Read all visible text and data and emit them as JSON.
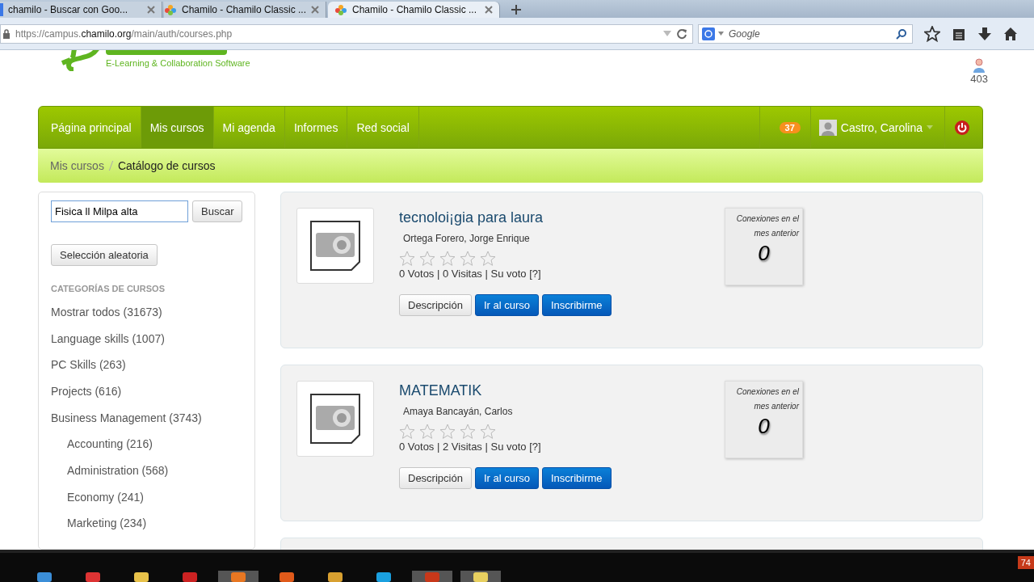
{
  "browser": {
    "tabs": [
      {
        "title": "chamilo - Buscar con Goo...",
        "selected": false,
        "kind": "google"
      },
      {
        "title": "Chamilo - Chamilo Classic ...",
        "selected": false,
        "kind": "chamilo"
      },
      {
        "title": "Chamilo - Chamilo Classic ...",
        "selected": true,
        "kind": "chamilo"
      }
    ],
    "url": {
      "prefix": "https://campus.",
      "domain": "chamilo.org",
      "path": "/main/auth/courses.php"
    },
    "search_placeholder": "Google"
  },
  "header": {
    "tagline": "E-Learning & Collaboration Software",
    "online_count": "403"
  },
  "nav": {
    "items": [
      {
        "label": "Página principal",
        "selected": false
      },
      {
        "label": "Mis cursos",
        "selected": true
      },
      {
        "label": "Mi agenda",
        "selected": false
      },
      {
        "label": "Informes",
        "selected": false
      },
      {
        "label": "Red social",
        "selected": false
      }
    ],
    "badge": "37",
    "user": "Castro, Carolina"
  },
  "breadcrumb": [
    {
      "label": "Mis cursos",
      "kind": "link"
    },
    {
      "label": "Catálogo de cursos",
      "kind": "current"
    }
  ],
  "sidebar": {
    "search_value": "Fisica ll Milpa alta",
    "search_button": "Buscar",
    "random_button": "Selección aleatoria",
    "heading": "CATEGORÍAS DE CURSOS",
    "categories": [
      {
        "label": "Mostrar todos (31673)"
      },
      {
        "label": "Language skills (1007)"
      },
      {
        "label": "PC Skills (263)"
      },
      {
        "label": "Projects (616)"
      },
      {
        "label": "Business Management (3743)",
        "children": [
          {
            "label": "Accounting (216)"
          },
          {
            "label": "Administration (568)"
          },
          {
            "label": "Economy (241)"
          },
          {
            "label": "Marketing (234)"
          }
        ]
      }
    ]
  },
  "courses": [
    {
      "title": "tecnoloi¡gia para laura",
      "teacher": "Ortega Forero, Jorge Enrique",
      "stars": 0,
      "stats": "0 Votos | 0 Visitas | Su voto [?]",
      "buttons": [
        "Descripción",
        "Ir al curso",
        "Inscribirme"
      ],
      "connections_label": "Conexiones en el mes anterior",
      "connections": "0"
    },
    {
      "title": "MATEMATIK",
      "teacher": "Amaya Bancayán, Carlos",
      "stars": 0,
      "stats": "0 Votos | 2 Visitas | Su voto [?]",
      "buttons": [
        "Descripción",
        "Ir al curso",
        "Inscribirme"
      ],
      "connections_label": "Conexiones en el mes anterior",
      "connections": "0"
    }
  ],
  "taskbar": {
    "badge": "74"
  }
}
